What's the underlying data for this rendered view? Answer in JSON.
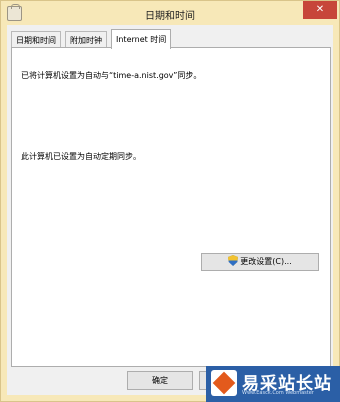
{
  "window": {
    "title": "日期和时间",
    "close_symbol": "✕"
  },
  "tabs": [
    {
      "label": "日期和时间",
      "active": false
    },
    {
      "label": "附加时钟",
      "active": false
    },
    {
      "label": "Internet 时间",
      "active": true
    }
  ],
  "panel": {
    "sync_text": "已将计算机设置为自动与“time-a.nist.gov”同步。",
    "schedule_text": "此计算机已设置为自动定期同步。",
    "change_button_label": "更改设置(C)...",
    "change_button_icon": "uac-shield-icon"
  },
  "footer": {
    "ok_label": "确定"
  },
  "watermark": {
    "brand": "易采站长站",
    "sub": "Www.Easck.Com  Webmaster"
  },
  "colors": {
    "titlebar": "#f7e8b8",
    "close": "#c7463a",
    "watermark": "#2b5fa6"
  }
}
